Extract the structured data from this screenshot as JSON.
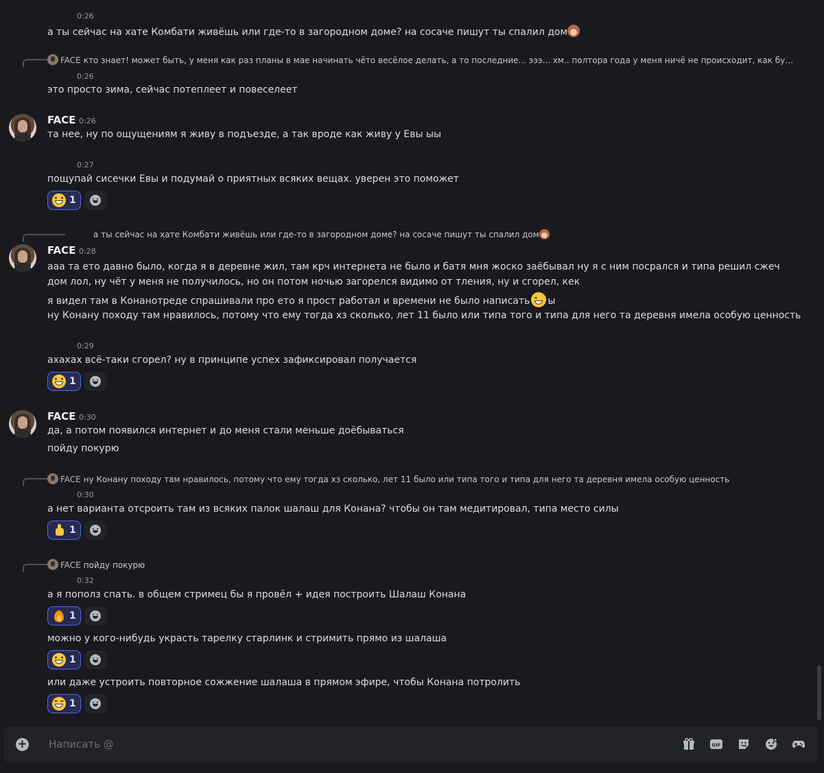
{
  "messages": [
    {
      "time": "0:26",
      "text": "а ты сейчас на хате Комбати живёшь или где-то в загородном доме? на сосаче пишут ты спалил дом"
    },
    {
      "reply_author": "FACE",
      "reply_text": "кто знает! может быть, у меня как раз планы в мае начинать чёто весёлое делать, а то последние... эээ... хм.. полтора года у меня ничё не происходит, как будто замор...",
      "time": "0:26",
      "text": "это просто зима, сейчас потеплеет и повеселеет"
    },
    {
      "author": "FACE",
      "time": "0:26",
      "text": "та нее, ну по ощущениям я живу в подъезде, а так вроде как живу у Евы ыы"
    },
    {
      "time": "0:27",
      "text": "пощупай сисечки Евы и подумай о приятных всяких вещах. уверен это поможет",
      "reaction_count": "1"
    },
    {
      "reply_text": "а ты сейчас на хате Комбати живёшь или где-то в загородном доме? на сосаче пишут ты спалил дом",
      "author": "FACE",
      "time": "0:28",
      "text1": "ааа та ето давно было, когда я в деревне жил, там крч интернета не было и батя мня жоско заёбывал ну я с ним посрался и типа решил сжеч дом лол, ну чёт у меня не получилось, но он потом ночью загорелся видимо от тления, ну и сгорел, кек",
      "text2a": "я видел там в Конанотреде спрашивали про ето я прост работал и времени не было написать",
      "text2b": "ы",
      "text3": "ну Конану походу там нравилось, потому что ему тогда хз сколько, лет 11 было или типа того и типа для него та деревня имела особую ценность"
    },
    {
      "time": "0:29",
      "text": "ахахах всё-таки сгорел? ну в принципе успех зафиксировал получается",
      "reaction_count": "1"
    },
    {
      "author": "FACE",
      "time": "0:30",
      "text1": "да, а потом появился интернет и до меня стали меньше доёбываться",
      "text2": "пойду покурю"
    },
    {
      "reply_author": "FACE",
      "reply_text": "ну Конану походу там нравилось, потому что ему тогда хз сколько, лет 11 было или типа того и типа для него та деревня имела особую ценность",
      "time": "0:30",
      "text": "а нет варианта отсроить там из всяких палок шалаш для Конана? чтобы он там медитировал, типа место силы",
      "reaction_count": "1"
    },
    {
      "reply_author": "FACE",
      "reply_text": "пойду покурю",
      "time": "0:32",
      "text": "а я пополз спать. в общем стримец бы я провёл + идея построить Шалаш Конана",
      "reaction_count": "1"
    },
    {
      "text": "можно у кого-нибудь украсть тарелку старлинк и стримить прямо из шалаша",
      "reaction_count": "1"
    },
    {
      "text": "или даже устроить повторное сожжение шалаша в прямом эфире, чтобы Конана потролить",
      "reaction_count": "1"
    }
  ],
  "composer": {
    "placeholder": "Написать @"
  },
  "icons": {
    "plus": "plus-circle-icon",
    "gift": "gift-icon",
    "gif": "gif-icon",
    "sticker": "sticker-icon",
    "emoji": "emoji-icon",
    "apps": "gamepad-icon"
  },
  "colors": {
    "background": "#1a1a1e",
    "reaction_bg": "#282a52",
    "reaction_border": "#5865f2"
  }
}
